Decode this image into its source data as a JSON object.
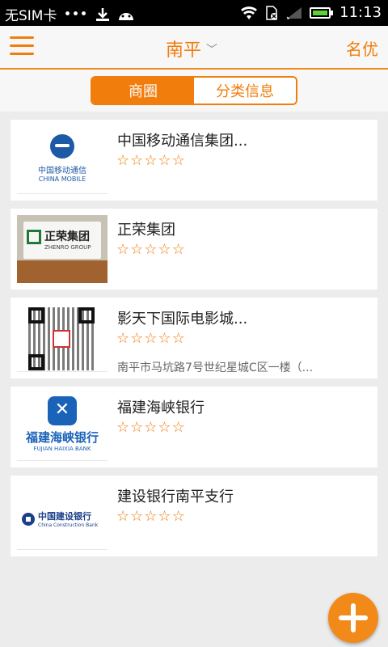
{
  "status_bar": {
    "carrier": "无SIM卡",
    "dots": "•••",
    "time": "11:13",
    "icons": [
      "download-icon",
      "android-icon",
      "wifi-icon",
      "sim-icon",
      "signal-icon",
      "battery-icon"
    ]
  },
  "header": {
    "city": "南平",
    "city_chevron": "﹀",
    "right_label": "名优"
  },
  "tabs": [
    {
      "label": "商圈",
      "active": true
    },
    {
      "label": "分类信息",
      "active": false
    }
  ],
  "list": [
    {
      "title": "中国移动通信集团...",
      "rating": 0,
      "logo_text": "中国移动通信",
      "logo_sub": "CHINA MOBILE"
    },
    {
      "title": "正荣集团",
      "rating": 0,
      "logo_text": "正荣集团",
      "logo_sub": "ZHENRO GROUP"
    },
    {
      "title": "影天下国际电影城...",
      "rating": 0,
      "address": "南平市马坑路7号世纪星城C区一楼（..."
    },
    {
      "title": "福建海峡银行",
      "rating": 0,
      "logo_text": "福建海峡银行",
      "logo_sub": "FUJIAN HAIXIA BANK"
    },
    {
      "title": "建设银行南平支行",
      "rating": 0,
      "logo_text": "中国建设银行",
      "logo_sub": "China Construction Bank"
    }
  ],
  "colors": {
    "accent": "#f07d0c",
    "background": "#ececec"
  }
}
